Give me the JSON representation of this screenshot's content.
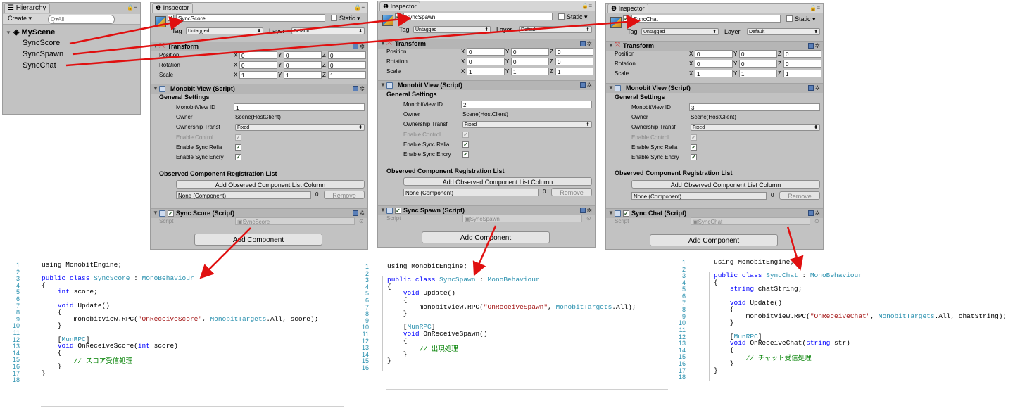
{
  "hierarchy": {
    "tab_label": "Hierarchy",
    "create_label": "Create",
    "search_placeholder": "All",
    "scene_name": "MyScene",
    "items": [
      {
        "label": "SyncScore"
      },
      {
        "label": "SyncSpawn"
      },
      {
        "label": "SyncChat"
      }
    ]
  },
  "inspectors": [
    {
      "tab_label": "Inspector",
      "object_name": "SyncScore",
      "static_label": "Static",
      "tag_label": "Tag",
      "tag_value": "Untagged",
      "layer_label": "Layer",
      "layer_value": "Default",
      "transform": {
        "title": "Transform",
        "position_label": "Position",
        "rotation_label": "Rotation",
        "scale_label": "Scale",
        "position": [
          "0",
          "0",
          "0"
        ],
        "rotation": [
          "0",
          "0",
          "0"
        ],
        "scale": [
          "1",
          "1",
          "1"
        ]
      },
      "monobit": {
        "title": "Monobit View (Script)",
        "general_settings": "General Settings",
        "view_id_label": "MonobitView ID",
        "view_id": "1",
        "owner_label": "Owner",
        "owner": "Scene(HostClient)",
        "ownership_label": "Ownership Transf",
        "ownership": "Fixed",
        "enable_control": "Enable Control",
        "enable_sync_reliable": "Enable Sync Relia",
        "enable_sync_encrypt": "Enable Sync Encry",
        "observed_title": "Observed Component Registration List",
        "add_observed": "Add Observed Component List Column",
        "none_component": "None (Component)",
        "count": "0",
        "remove": "Remove"
      },
      "script_component": {
        "title": "Sync Score (Script)",
        "script_label": "Script",
        "script_value": "SyncScore"
      },
      "add_component": "Add Component"
    },
    {
      "tab_label": "Inspector",
      "object_name": "SyncSpawn",
      "static_label": "Static",
      "tag_label": "Tag",
      "tag_value": "Untagged",
      "layer_label": "Layer",
      "layer_value": "Default",
      "transform": {
        "title": "Transform",
        "position_label": "Position",
        "rotation_label": "Rotation",
        "scale_label": "Scale",
        "position": [
          "0",
          "0",
          "0"
        ],
        "rotation": [
          "0",
          "0",
          "0"
        ],
        "scale": [
          "1",
          "1",
          "1"
        ]
      },
      "monobit": {
        "title": "Monobit View (Script)",
        "general_settings": "General Settings",
        "view_id_label": "MonobitView ID",
        "view_id": "2",
        "owner_label": "Owner",
        "owner": "Scene(HostClient)",
        "ownership_label": "Ownership Transf",
        "ownership": "Fixed",
        "enable_control": "Enable Control",
        "enable_sync_reliable": "Enable Sync Relia",
        "enable_sync_encrypt": "Enable Sync Encry",
        "observed_title": "Observed Component Registration List",
        "add_observed": "Add Observed Component List Column",
        "none_component": "None (Component)",
        "count": "0",
        "remove": "Remove"
      },
      "script_component": {
        "title": "Sync Spawn (Script)",
        "script_label": "Script",
        "script_value": "SyncSpawn"
      },
      "add_component": "Add Component"
    },
    {
      "tab_label": "Inspector",
      "object_name": "SyncChat",
      "static_label": "Static",
      "tag_label": "Tag",
      "tag_value": "Untagged",
      "layer_label": "Layer",
      "layer_value": "Default",
      "transform": {
        "title": "Transform",
        "position_label": "Position",
        "rotation_label": "Rotation",
        "scale_label": "Scale",
        "position": [
          "0",
          "0",
          "0"
        ],
        "rotation": [
          "0",
          "0",
          "0"
        ],
        "scale": [
          "1",
          "1",
          "1"
        ]
      },
      "monobit": {
        "title": "Monobit View (Script)",
        "general_settings": "General Settings",
        "view_id_label": "MonobitView ID",
        "view_id": "3",
        "owner_label": "Owner",
        "owner": "Scene(HostClient)",
        "ownership_label": "Ownership Transf",
        "ownership": "Fixed",
        "enable_control": "Enable Control",
        "enable_sync_reliable": "Enable Sync Relia",
        "enable_sync_encrypt": "Enable Sync Encry",
        "observed_title": "Observed Component Registration List",
        "add_observed": "Add Observed Component List Column",
        "none_component": "None (Component)",
        "count": "0",
        "remove": "Remove"
      },
      "script_component": {
        "title": "Sync Chat (Script)",
        "script_label": "Script",
        "script_value": "SyncChat"
      },
      "add_component": "Add Component"
    }
  ],
  "axis_labels": {
    "x": "X",
    "y": "Y",
    "z": "Z"
  },
  "code_blocks": [
    {
      "name": "SyncScore",
      "lines": [
        [
          [
            "using MonobitEngine;",
            "pl"
          ]
        ],
        [],
        [
          [
            "public class ",
            "kw"
          ],
          [
            "SyncScore",
            "ty"
          ],
          [
            " : ",
            "pl"
          ],
          [
            "MonoBehaviour",
            "ty"
          ]
        ],
        [
          [
            "{",
            "pl"
          ]
        ],
        [
          [
            "    ",
            "pl"
          ],
          [
            "int",
            "kw"
          ],
          [
            " score;",
            "pl"
          ]
        ],
        [],
        [
          [
            "    ",
            "pl"
          ],
          [
            "void",
            "kw"
          ],
          [
            " Update()",
            "pl"
          ]
        ],
        [
          [
            "    {",
            "pl"
          ]
        ],
        [
          [
            "        monobitView.RPC(",
            "pl"
          ],
          [
            "\"OnReceiveScore\"",
            "st"
          ],
          [
            ", ",
            "pl"
          ],
          [
            "MonobitTargets",
            "ty"
          ],
          [
            ".All, score);",
            "pl"
          ]
        ],
        [
          [
            "    }",
            "pl"
          ]
        ],
        [],
        [
          [
            "    [",
            "pl"
          ],
          [
            "MunRPC",
            "ty"
          ],
          [
            "]",
            "pl"
          ]
        ],
        [
          [
            "    ",
            "pl"
          ],
          [
            "void",
            "kw"
          ],
          [
            " OnReceiveScore(",
            "pl"
          ],
          [
            "int",
            "kw"
          ],
          [
            " score)",
            "pl"
          ]
        ],
        [
          [
            "    {",
            "pl"
          ]
        ],
        [
          [
            "        // スコア受信処理",
            "cm"
          ]
        ],
        [
          [
            "    }",
            "pl"
          ]
        ],
        [
          [
            "}",
            "pl"
          ]
        ],
        []
      ]
    },
    {
      "name": "SyncSpawn",
      "lines": [
        [
          [
            "using MonobitEngine;",
            "pl"
          ]
        ],
        [],
        [
          [
            "public class ",
            "kw"
          ],
          [
            "SyncSpawn",
            "ty"
          ],
          [
            " : ",
            "pl"
          ],
          [
            "MonoBehaviour",
            "ty"
          ]
        ],
        [
          [
            "{",
            "pl"
          ]
        ],
        [
          [
            "    ",
            "pl"
          ],
          [
            "void",
            "kw"
          ],
          [
            " Update()",
            "pl"
          ]
        ],
        [
          [
            "    {",
            "pl"
          ]
        ],
        [
          [
            "        monobitView.RPC(",
            "pl"
          ],
          [
            "\"OnReceiveSpawn\"",
            "st"
          ],
          [
            ", ",
            "pl"
          ],
          [
            "MonobitTargets",
            "ty"
          ],
          [
            ".All);",
            "pl"
          ]
        ],
        [
          [
            "    }",
            "pl"
          ]
        ],
        [],
        [
          [
            "    [",
            "pl"
          ],
          [
            "MunRPC",
            "ty"
          ],
          [
            "]",
            "pl"
          ]
        ],
        [
          [
            "    ",
            "pl"
          ],
          [
            "void",
            "kw"
          ],
          [
            " OnReceiveSpawn()",
            "pl"
          ]
        ],
        [
          [
            "    {",
            "pl"
          ]
        ],
        [
          [
            "        // 出現処理",
            "cm"
          ]
        ],
        [
          [
            "    }",
            "pl"
          ]
        ],
        [
          [
            "}",
            "pl"
          ]
        ],
        []
      ]
    },
    {
      "name": "SyncChat",
      "lines": [
        [
          [
            "using MonobitEngine;",
            "pl"
          ]
        ],
        [],
        [
          [
            "public class ",
            "kw"
          ],
          [
            "SyncChat",
            "ty"
          ],
          [
            " : ",
            "pl"
          ],
          [
            "MonoBehaviour",
            "ty"
          ]
        ],
        [
          [
            "{",
            "pl"
          ]
        ],
        [
          [
            "    ",
            "pl"
          ],
          [
            "string",
            "kw"
          ],
          [
            " chatString;",
            "pl"
          ]
        ],
        [],
        [
          [
            "    ",
            "pl"
          ],
          [
            "void",
            "kw"
          ],
          [
            " Update()",
            "pl"
          ]
        ],
        [
          [
            "    {",
            "pl"
          ]
        ],
        [
          [
            "        monobitView.RPC(",
            "pl"
          ],
          [
            "\"OnReceiveChat\"",
            "st"
          ],
          [
            ", ",
            "pl"
          ],
          [
            "MonobitTargets",
            "ty"
          ],
          [
            ".All, chatString);",
            "pl"
          ]
        ],
        [
          [
            "    }",
            "pl"
          ]
        ],
        [],
        [
          [
            "    [",
            "pl"
          ],
          [
            "MunRPC",
            "ty"
          ],
          [
            "]",
            "pl"
          ]
        ],
        [
          [
            "    ",
            "pl"
          ],
          [
            "void",
            "kw"
          ],
          [
            " OnReceiveChat(",
            "pl"
          ],
          [
            "string",
            "kw"
          ],
          [
            " str)",
            "pl"
          ]
        ],
        [
          [
            "    {",
            "pl"
          ]
        ],
        [
          [
            "        // チャット受信処理",
            "cm"
          ]
        ],
        [
          [
            "    }",
            "pl"
          ]
        ],
        [
          [
            "}",
            "pl"
          ]
        ],
        []
      ]
    }
  ],
  "colors": {
    "arrow": "#e01010",
    "keyword": "#0000ff",
    "type": "#2b91af",
    "string": "#a31515",
    "comment": "#008000",
    "panel": "#c2c2c2"
  },
  "icons": [
    "hierarchy-icon",
    "unity-logo-icon",
    "lock-icon",
    "menu-icon",
    "cube-icon",
    "transform-icon",
    "script-icon",
    "help-book-icon",
    "gear-icon",
    "checkbox-icon",
    "dropdown-arrow-icon",
    "fold-arrow-icon",
    "search-icon"
  ]
}
